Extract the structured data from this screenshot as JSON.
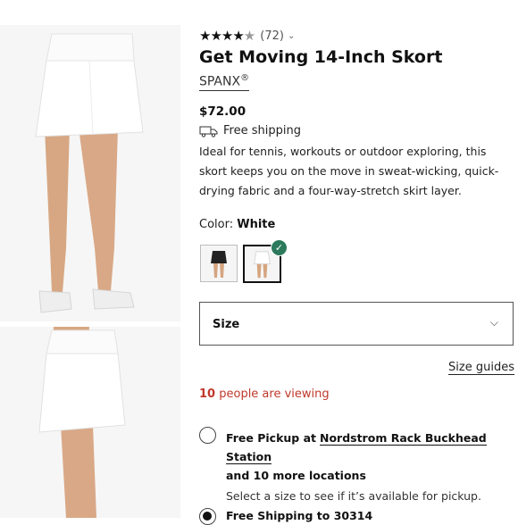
{
  "product": {
    "rating_count": "(72)",
    "rating_value": 4.5,
    "title": "Get Moving 14-Inch Skort",
    "brand": "SPANX",
    "brand_mark": "®",
    "price": "$72.00",
    "shipping": "Free shipping",
    "description": "Ideal for tennis, workouts or outdoor exploring, this skort keeps you on the move in sweat-wicking, quick-drying fabric and a four-way-stretch skirt layer."
  },
  "color": {
    "label": "Color:",
    "selected": "White",
    "swatches": [
      {
        "name": "Black",
        "selected": false
      },
      {
        "name": "White",
        "selected": true
      }
    ],
    "check_color": "#2b7a5b"
  },
  "size": {
    "label": "Size",
    "guides": "Size guides"
  },
  "viewing": {
    "count": "10",
    "text": "people are viewing",
    "color": "#c0392b"
  },
  "fulfillment": {
    "pickup_lead": "Free Pickup at",
    "pickup_store": "Nordstrom Rack Buckhead Station",
    "pickup_more": "and 10 more locations",
    "pickup_sub": "Select a size to see if it’s available for pickup.",
    "shipping_text": "Free Shipping to 30314"
  }
}
